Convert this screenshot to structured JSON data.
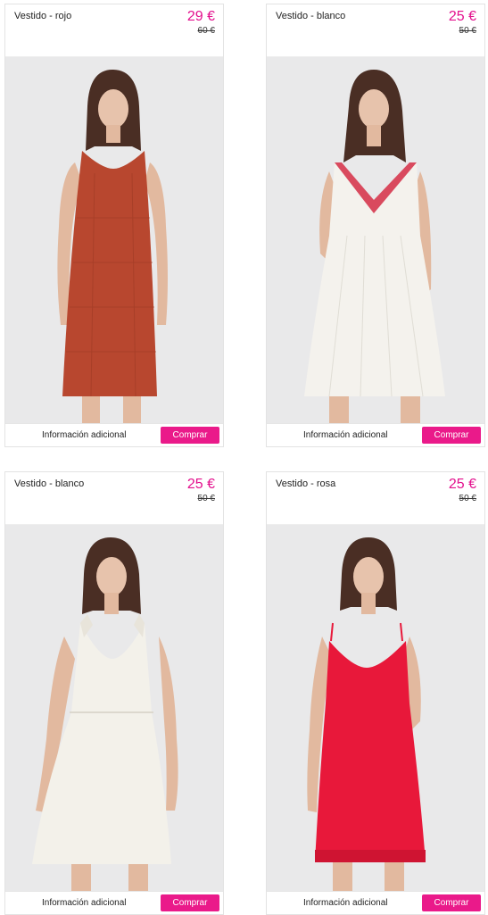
{
  "products": [
    {
      "title": "Vestido - rojo",
      "price": "29 €",
      "old_price": "60 €",
      "info_label": "Información adicional",
      "buy_label": "Comprar",
      "dress_color": "#b8472f",
      "trim_color": "#b8472f"
    },
    {
      "title": "Vestido - blanco",
      "price": "25 €",
      "old_price": "50 €",
      "info_label": "Información adicional",
      "buy_label": "Comprar",
      "dress_color": "#f4f2ed",
      "trim_color": "#d94a5e"
    },
    {
      "title": "Vestido - blanco",
      "price": "25 €",
      "old_price": "50 €",
      "info_label": "Información adicional",
      "buy_label": "Comprar",
      "dress_color": "#f3f1ea",
      "trim_color": "#f3f1ea"
    },
    {
      "title": "Vestido - rosa",
      "price": "25 €",
      "old_price": "50 €",
      "info_label": "Información adicional",
      "buy_label": "Comprar",
      "dress_color": "#e8183a",
      "trim_color": "#e8183a"
    }
  ],
  "colors": {
    "accent": "#e3108d",
    "button": "#ea1a8a",
    "photo_bg": "#e9e9ea"
  }
}
